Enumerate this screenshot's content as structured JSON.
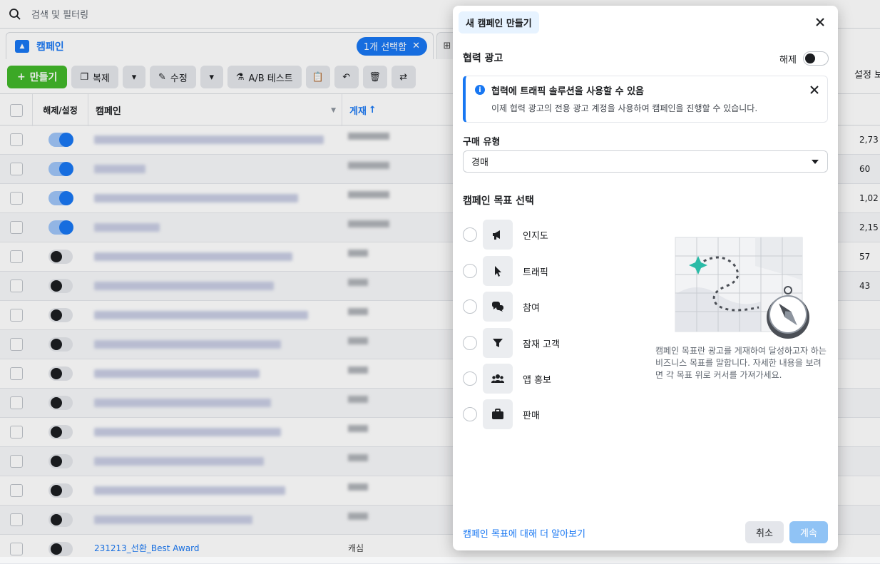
{
  "search": {
    "placeholder": "검색 및 필터링"
  },
  "tabs": {
    "campaign": "캠페인",
    "selected": "1개 선택함"
  },
  "toolbar": {
    "create": "만들기",
    "duplicate": "복제",
    "edit": "수정",
    "ab_test": "A/B 테스트",
    "settings_right": "설정 보"
  },
  "grid": {
    "headers": {
      "toggle": "해제/설정",
      "campaign": "캠페인",
      "delivery": "게재"
    },
    "toggles": [
      true,
      true,
      true,
      true,
      false,
      false,
      false,
      false,
      false,
      false,
      false,
      false,
      false,
      false,
      false
    ],
    "right_values": [
      "2,73",
      "60",
      "1,02",
      "2,15",
      "57",
      "43"
    ],
    "last_row_name": "231213_선환_Best Award",
    "last_row_status": "캐심"
  },
  "modal": {
    "title": "새 캠페인 만들기",
    "partner_ads_label": "협력 광고",
    "partner_ads_state": "해제",
    "info": {
      "title": "협력에 트래픽 솔루션을 사용할 수 있음",
      "desc": "이제 협력 광고의 전용 광고 계정을 사용하여 캠페인을 진행할 수 있습니다."
    },
    "buying_type_label": "구매 유형",
    "buying_type_value": "경매",
    "objective_title": "캠페인 목표 선택",
    "objectives": [
      {
        "label": "인지도",
        "icon": "megaphone-icon"
      },
      {
        "label": "트래픽",
        "icon": "cursor-icon"
      },
      {
        "label": "참여",
        "icon": "chat-bubbles-icon"
      },
      {
        "label": "잠재 고객",
        "icon": "filter-icon"
      },
      {
        "label": "앱 홍보",
        "icon": "people-icon"
      },
      {
        "label": "판매",
        "icon": "briefcase-icon"
      }
    ],
    "objective_desc": "캠페인 목표란 광고를 게재하여 달성하고자 하는 비즈니스 목표를 말합니다. 자세한 내용을 보려면 각 목표 위로 커서를 가져가세요.",
    "learn_more": "캠페인 목표에 대해 더 알아보기",
    "cancel": "취소",
    "continue": "계속"
  }
}
